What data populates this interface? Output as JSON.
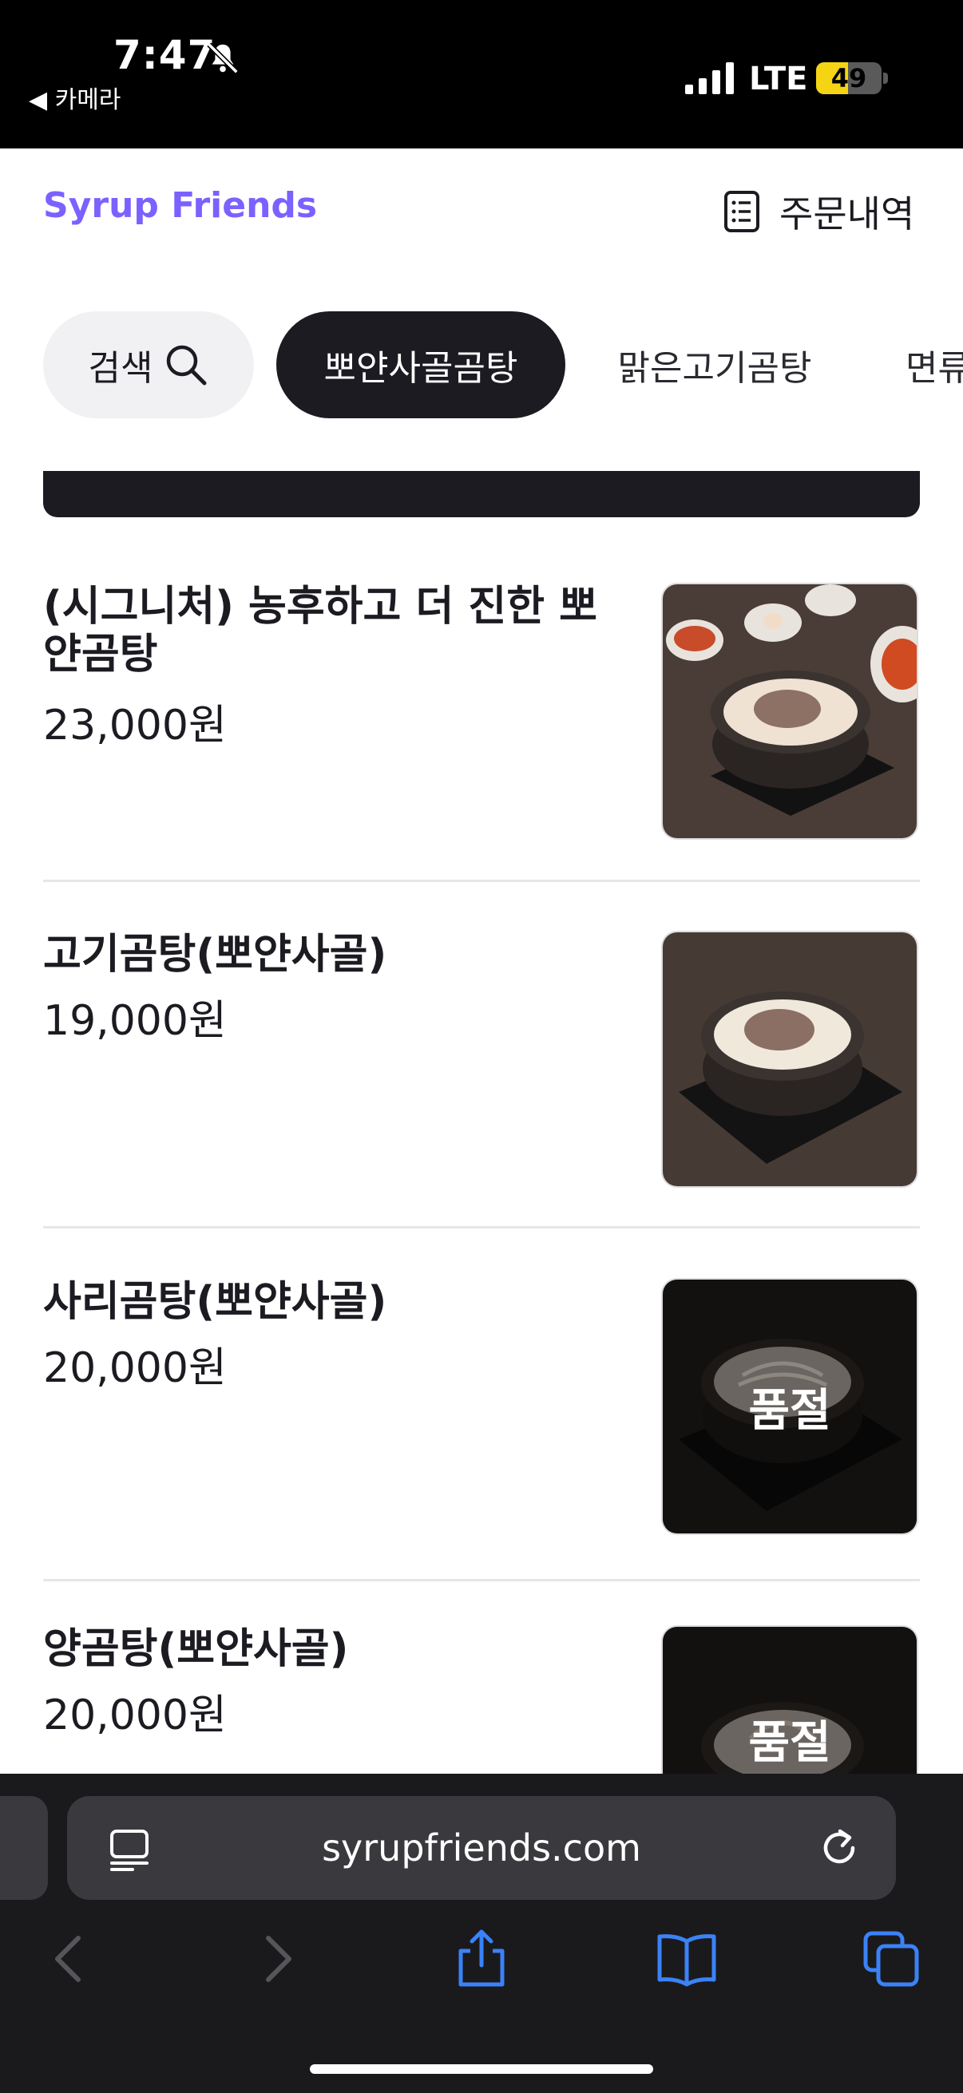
{
  "status_bar": {
    "time": "7:47",
    "back_label": "◀ 카메라",
    "network": "LTE",
    "battery": "49",
    "battery_level": 0.49
  },
  "header": {
    "brand": "Syrup Friends",
    "orders_label": "주문내역"
  },
  "tabs": [
    {
      "label": "검색",
      "active": false
    },
    {
      "label": "뽀얀사골곰탕",
      "active": true
    },
    {
      "label": "맑은고기곰탕",
      "active": false
    },
    {
      "label": "면류",
      "active": false
    }
  ],
  "menu_items": [
    {
      "name": "(시그니처) 농후하고 더 진한 뽀얀곰탕",
      "price": "23,000원",
      "sold_out": false
    },
    {
      "name": "고기곰탕(뽀얀사골)",
      "price": "19,000원",
      "sold_out": false
    },
    {
      "name": "사리곰탕(뽀얀사골)",
      "price": "20,000원",
      "sold_out": true,
      "badge": "품절"
    },
    {
      "name": "양곰탕(뽀얀사골)",
      "price": "20,000원",
      "sold_out": true,
      "badge": "품절"
    }
  ],
  "browser": {
    "url": "syrupfriends.com"
  },
  "colors": {
    "brand": "#7b61ff",
    "active_tab_bg": "#1c1b22",
    "browser_accent": "#3b82f6",
    "battery_fill": "#f5d414"
  }
}
